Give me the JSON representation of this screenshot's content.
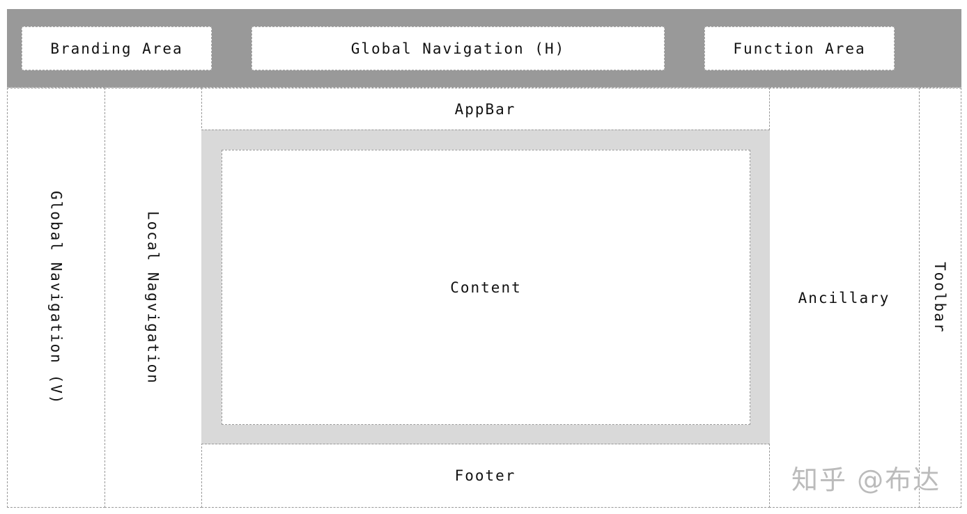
{
  "header": {
    "branding": "Branding Area",
    "global_nav_h": "Global Navigation (H)",
    "function_area": "Function Area"
  },
  "columns": {
    "global_nav_v": "Global Navigation (V)",
    "local_nav": "Local Nagvigation",
    "appbar": "AppBar",
    "content": "Content",
    "footer": "Footer",
    "ancillary": "Ancillary",
    "toolbar": "Toolbar"
  },
  "watermark": "知乎 @布达",
  "colors": {
    "header_band": "#999999",
    "content_frame": "#d9d9d9"
  }
}
